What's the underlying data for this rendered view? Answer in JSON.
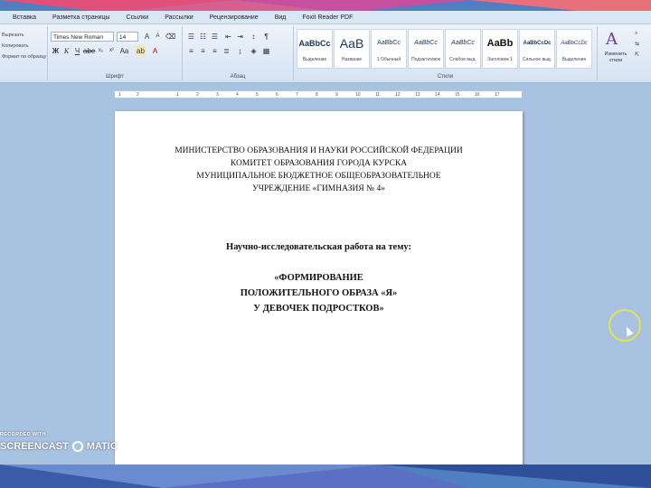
{
  "menu": {
    "items": [
      "Вставка",
      "Разметка страницы",
      "Ссылки",
      "Рассылки",
      "Рецензирование",
      "Вид",
      "Foxit Reader PDF"
    ]
  },
  "ribbon": {
    "clipboard_items": [
      "Вырезать",
      "Копировать",
      "Формат по образцу"
    ],
    "font_name": "Times New Roman",
    "font_size": "14",
    "font_group_label": "Шрифт",
    "paragraph_group_label": "Абзац",
    "styles_group_label": "Стили",
    "styles": [
      {
        "sample": "AaBbCc",
        "name": "Выделение"
      },
      {
        "sample": "АаВ",
        "name": "Название"
      },
      {
        "sample": "AaBbCc",
        "name": "1 Обычный"
      },
      {
        "sample": "AaBbCc",
        "name": "Подзаголовок"
      },
      {
        "sample": "AaBbCc",
        "name": "Слабое выд."
      },
      {
        "sample": "AaBb",
        "name": "Заголовок 1"
      },
      {
        "sample": "AaBbCcDc",
        "name": "Сильное выд."
      },
      {
        "sample": "AaBbCcDc",
        "name": "Выделение"
      }
    ],
    "change_styles_label": "Изменить стили"
  },
  "ruler": {
    "numbers": [
      "1",
      "2",
      "1",
      "2",
      "3",
      "4",
      "5",
      "6",
      "7",
      "8",
      "9",
      "10",
      "11",
      "12",
      "13",
      "14",
      "15",
      "16",
      "17"
    ]
  },
  "document": {
    "header_lines": [
      "МИНИСТЕРСТВО ОБРАЗОВАНИЯ И НАУКИ РОССИЙСКОЙ ФЕДЕРАЦИИ",
      "КОМИТЕТ ОБРАЗОВАНИЯ ГОРОДА КУРСКА",
      "МУНИЦИПАЛЬНОЕ БЮДЖЕТНОЕ ОБЩЕОБРАЗОВАТЕЛЬНОЕ",
      "УЧРЕЖДЕНИЕ «ГИМНАЗИЯ № 4»"
    ],
    "subtitle": "Научно-исследовательская работа на тему:",
    "title_lines": [
      "«ФОРМИРОВАНИЕ",
      "ПОЛОЖИТЕЛЬНОГО ОБРАЗА «Я»",
      "У ДЕВОЧЕК ПОДРОСТКОВ»"
    ]
  },
  "watermark": {
    "recorded_with": "RECORDED WITH",
    "brand_left": "SCREENCAST",
    "brand_right": "MATIC"
  },
  "colors": {
    "ribbon": "#dbe6f4",
    "workspace": "#a8c2e2",
    "cursor_ring": "#e2e64b"
  }
}
